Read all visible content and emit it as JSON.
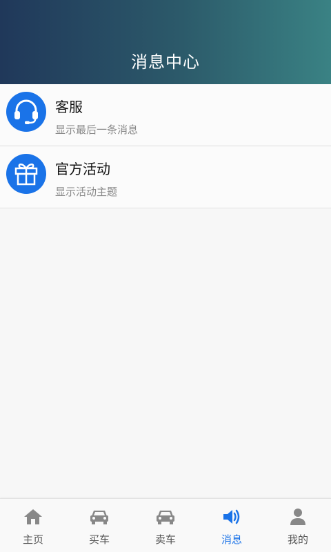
{
  "header": {
    "title": "消息中心"
  },
  "messages": [
    {
      "title": "客服",
      "subtitle": "显示最后一条消息",
      "icon": "headset-icon"
    },
    {
      "title": "官方活动",
      "subtitle": "显示活动主题",
      "icon": "gift-icon"
    }
  ],
  "tabbar": {
    "active": 3,
    "items": [
      {
        "label": "主页",
        "icon": "home-icon"
      },
      {
        "label": "买车",
        "icon": "car-icon"
      },
      {
        "label": "卖车",
        "icon": "car-icon"
      },
      {
        "label": "消息",
        "icon": "speaker-icon"
      },
      {
        "label": "我的",
        "icon": "person-icon"
      }
    ]
  },
  "colors": {
    "accent": "#1a73e8",
    "header_start": "#20385a",
    "header_end": "#3a8284",
    "tab_inactive": "#888888"
  }
}
